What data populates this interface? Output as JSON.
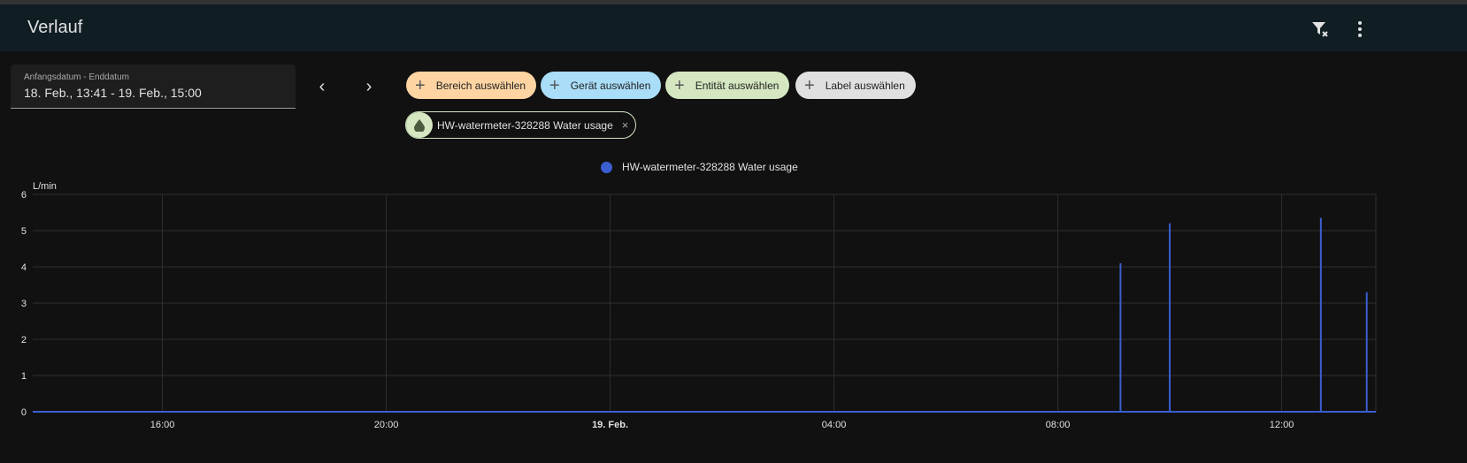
{
  "header": {
    "title": "Verlauf",
    "filter_clear_icon": "filter-remove-icon",
    "menu_icon": "dots-vertical-icon"
  },
  "date_picker": {
    "label": "Anfangsdatum - Enddatum",
    "value": "18. Feb., 13:41 - 19. Feb., 15:00"
  },
  "nav": {
    "prev": "‹",
    "next": "›"
  },
  "chips": [
    {
      "label": "Bereich auswählen",
      "color": "#fdd4a2"
    },
    {
      "label": "Gerät auswählen",
      "color": "#a9ddf8"
    },
    {
      "label": "Entität auswählen",
      "color": "#d4e7c1"
    },
    {
      "label": "Label auswählen",
      "color": "#e0e0e0"
    }
  ],
  "selected_entity": {
    "label": "HW-watermeter-328288 Water usage",
    "icon": "water-icon",
    "remove": "×"
  },
  "chart_data": {
    "type": "line",
    "title": "",
    "legend": [
      {
        "name": "HW-watermeter-328288 Water usage",
        "color": "#3b5fd1"
      }
    ],
    "legend_placement": "top-center",
    "ylabel": "L/min",
    "ylim": [
      0,
      6
    ],
    "yticks": [
      "0",
      "1",
      "2",
      "3",
      "4",
      "5",
      "6"
    ],
    "xlim_hours": [
      -10.317,
      13.683
    ],
    "xticks": [
      {
        "label": "16:00",
        "h": -8
      },
      {
        "label": "20:00",
        "h": -4
      },
      {
        "label": "19. Feb.",
        "h": 0,
        "bold": true
      },
      {
        "label": "04:00",
        "h": 4
      },
      {
        "label": "08:00",
        "h": 8
      },
      {
        "label": "12:00",
        "h": 12
      }
    ],
    "grid": true,
    "series": [
      {
        "name": "HW-watermeter-328288 Water usage",
        "baseline": 0,
        "spikes": [
          {
            "time": "09:07",
            "h": 9.12,
            "value": 4.1
          },
          {
            "time": "10:00",
            "h": 10.0,
            "value": 5.2
          },
          {
            "time": "12:42",
            "h": 12.7,
            "value": 5.35
          },
          {
            "time": "13:31",
            "h": 13.52,
            "value": 3.3
          }
        ]
      }
    ]
  }
}
